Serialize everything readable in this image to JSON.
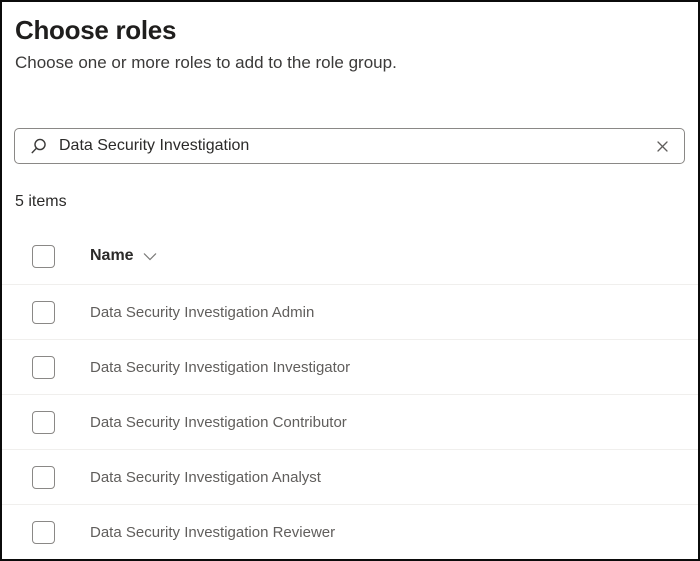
{
  "page": {
    "title": "Choose roles",
    "subtitle": "Choose one or more roles to add to the role group."
  },
  "search": {
    "value": "Data Security Investigation",
    "icons": {
      "left": "search-icon",
      "right": "clear-x-icon"
    }
  },
  "list": {
    "count_label": "5 items",
    "header": {
      "name_label": "Name",
      "sort_icon": "chevron-down-icon"
    },
    "rows": [
      {
        "label": "Data Security Investigation Admin",
        "checked": false
      },
      {
        "label": "Data Security Investigation Investigator",
        "checked": false
      },
      {
        "label": "Data Security Investigation Contributor",
        "checked": false
      },
      {
        "label": "Data Security Investigation Analyst",
        "checked": false
      },
      {
        "label": "Data Security Investigation Reviewer",
        "checked": false
      }
    ]
  },
  "colors": {
    "frame_border": "#0b0b0b",
    "input_border": "#8a8886",
    "divider": "#f0efed",
    "text_primary": "#2b2a29",
    "text_secondary": "#605e5c"
  }
}
